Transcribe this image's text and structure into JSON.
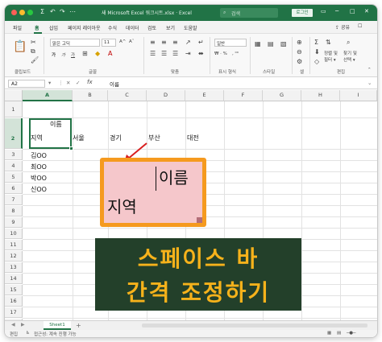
{
  "titlebar": {
    "title": "새 Microsoft Excel 워크시트.xlsx · Excel",
    "search_placeholder": "검색",
    "signin_label": "로그인",
    "qat_sum": "Σ",
    "qat_undo": "↶",
    "qat_redo": "↷",
    "qat_more": "⋯"
  },
  "ribbon_tabs": {
    "items": [
      "파일",
      "홈",
      "삽입",
      "페이지 레이아웃",
      "수식",
      "데이터",
      "검토",
      "보기",
      "도움말"
    ],
    "active_index": 1,
    "share_label": "공유",
    "comment_label": "☐"
  },
  "ribbon": {
    "groups": [
      "클립보드",
      "글꼴",
      "맞춤",
      "표시 형식",
      "스타일",
      "셀",
      "편집"
    ],
    "font_name": "맑은 고딕",
    "font_size": "11",
    "number_format": "일반",
    "bold": "가",
    "italic": "가",
    "underline": "가",
    "wrap_label": "정렬 및",
    "find_label": "찾기 및",
    "filter_label": "필터 ▾",
    "select_label": "선택 ▾"
  },
  "formula_bar": {
    "cell_ref": "A2",
    "fx_label": "fx",
    "value": "이름"
  },
  "grid": {
    "columns": [
      "A",
      "B",
      "C",
      "D",
      "E",
      "F",
      "G",
      "H",
      "I"
    ],
    "selected_column": "A",
    "rows": [
      "1",
      "2",
      "3",
      "4",
      "5",
      "6",
      "7",
      "8",
      "9",
      "10",
      "11",
      "12",
      "13",
      "14",
      "15",
      "16",
      "17",
      "18",
      "19"
    ],
    "selected_row": "2",
    "cells": {
      "A2_top": "이름",
      "A2_bottom": "지역",
      "B2": "서울",
      "C2": "경기",
      "D2": "부산",
      "E2": "대전",
      "A3": "김OO",
      "A4": "최OO",
      "A5": "박OO",
      "A6": "신OO"
    }
  },
  "callout": {
    "top_text": "이름",
    "bottom_text": "지역",
    "border_color": "#f59a1f",
    "fill_color": "#f5c7cb"
  },
  "banner": {
    "line1": "스페이스 바",
    "line2": "간격 조정하기",
    "bg_color": "#23402a",
    "text_color": "#f6b21b"
  },
  "sheets": {
    "tabs": [
      "Sheet1"
    ],
    "add_label": "+",
    "nav_prev": "◀",
    "nav_next": "▶"
  },
  "status": {
    "mode": "편집",
    "accessibility": "접근성: 계속 진행 가능"
  },
  "colors": {
    "accent": "#217346"
  }
}
